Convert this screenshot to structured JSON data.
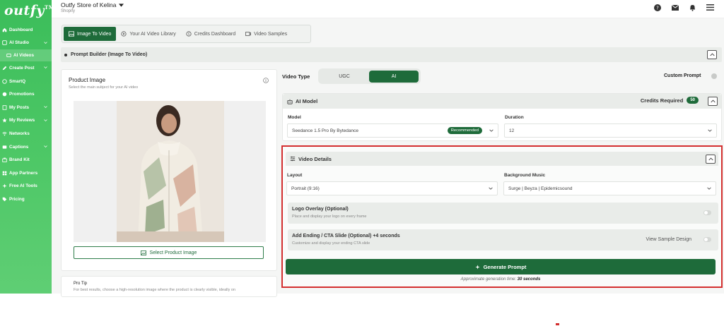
{
  "app": {
    "logo": "outfy",
    "logo_mark": "TM"
  },
  "sidebar": {
    "items": [
      {
        "label": "Dashboard"
      },
      {
        "label": "AI Studio"
      },
      {
        "label": "AI Videos"
      },
      {
        "label": "Create Post"
      },
      {
        "label": "SmartQ"
      },
      {
        "label": "Promotions"
      },
      {
        "label": "My Posts"
      },
      {
        "label": "My Reviews"
      },
      {
        "label": "Networks"
      },
      {
        "label": "Captions"
      },
      {
        "label": "Brand Kit"
      },
      {
        "label": "App Partners"
      },
      {
        "label": "Free AI Tools"
      },
      {
        "label": "Pricing"
      }
    ]
  },
  "topbar": {
    "store": "Outfy Store of Kelina",
    "platform": "Shopify"
  },
  "tabs": [
    {
      "label": "Image To Video"
    },
    {
      "label": "Your AI Video Library"
    },
    {
      "label": "Credits Dashboard"
    },
    {
      "label": "Video Samples"
    }
  ],
  "prompt_builder": {
    "title": "Prompt Builder (Image To Video)"
  },
  "product_image": {
    "title": "Product Image",
    "subtitle": "Select the main subject for your AI video",
    "button": "Select Product Image"
  },
  "pro_tip": {
    "title": "Pro Tip",
    "text": "For best results, choose a high-resolution image where the product is clearly visible, ideally on"
  },
  "video_type": {
    "label": "Video Type",
    "options": [
      "UGC",
      "AI"
    ],
    "selected": "AI"
  },
  "custom_prompt": {
    "label": "Custom Prompt"
  },
  "ai_model": {
    "title": "AI Model",
    "credits_label": "Credits Required",
    "credits": "50",
    "model_label": "Model",
    "model_value": "Seedance 1.5 Pro By Bytedance",
    "model_badge": "Recommended",
    "duration_label": "Duration",
    "duration_value": "12"
  },
  "video_details": {
    "title": "Video Details",
    "layout_label": "Layout",
    "layout_value": "Portrait (9:16)",
    "music_label": "Background Music",
    "music_value": "Surge | Beyza | Epidemicsound",
    "logo_title": "Logo Overlay (Optional)",
    "logo_sub": "Place and display your logo on every frame",
    "ending_title": "Add Ending / CTA Slide (Optional) +4 seconds",
    "ending_sub": "Customize and display your ending CTA slide",
    "sample_link": "View Sample Design",
    "generate": "Generate Prompt",
    "note_prefix": "Approximate generation time:",
    "note_time": "30 seconds"
  },
  "colors": {
    "brand": "#1e6b3a",
    "sidebar": "#4cc765",
    "highlight": "#d32f2f"
  }
}
